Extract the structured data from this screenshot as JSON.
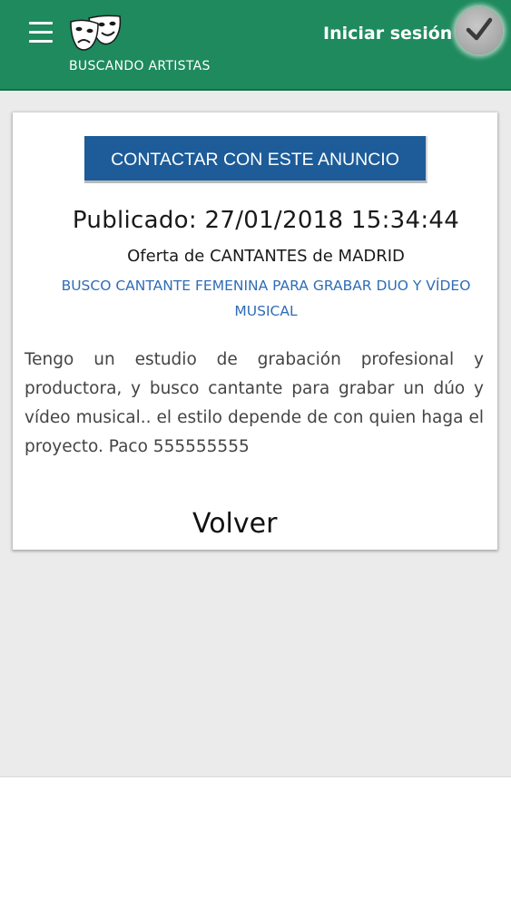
{
  "header": {
    "brand_name": "BUSCANDO ARTISTAS",
    "login_label": "Iniciar sesión",
    "icons": {
      "menu": "hamburger-menu-icon",
      "logo": "theater-masks-icon",
      "avatar": "checkmark-icon"
    },
    "colors": {
      "header_bg": "#1e8a5e",
      "button_bg": "#1d5c99",
      "title_link": "#2f6db5"
    }
  },
  "ad": {
    "contact_button_label": "CONTACTAR CON ESTE ANUNCIO",
    "published": "Publicado: 27/01/2018 15:34:44",
    "offer_type": "Oferta de CANTANTES de MADRID",
    "title": "BUSCO CANTANTE FEMENINA PARA GRABAR DUO Y VÍDEO MUSICAL",
    "body": "Tengo un estudio de grabación profesional y productora, y busco cantante para grabar un dúo y vídeo musical.. el estilo depende de con quien haga el proyecto. Paco 555555555",
    "back_label": "Volver"
  }
}
